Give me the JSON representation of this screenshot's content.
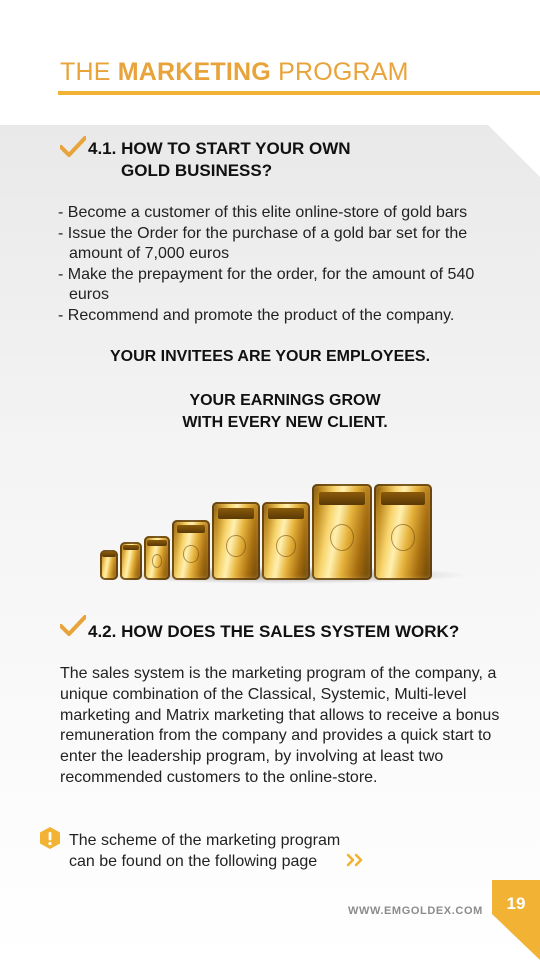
{
  "header": {
    "title_pre": "THE ",
    "title_bold": "MARKETING",
    "title_post": " PROGRAM"
  },
  "section1": {
    "heading_line1": "4.1. HOW TO START YOUR OWN",
    "heading_line2": "GOLD BUSINESS?",
    "bullets": [
      "- Become a customer of this elite online-store of gold bars",
      "- Issue the Order for the purchase of a gold bar set for the amount of 7,000 euros",
      "- Make the prepayment for the order, for the amount of 540 euros",
      "- Recommend and promote the product of the company."
    ],
    "callout1": "YOUR INVITEES ARE YOUR EMPLOYEES.",
    "callout2_line1": "YOUR EARNINGS GROW",
    "callout2_line2": "WITH EVERY NEW CLIENT."
  },
  "section2": {
    "heading": "4.2. HOW DOES THE SALES SYSTEM WORK?",
    "paragraph": "The sales system is the marketing program of the company, a unique combination of the Classical, Systemic, Multi-level marketing and Matrix marketing that allows to receive a bonus remuneration from the company and provides a quick start to enter the leadership program, by involving at least two recommended customers to the online-store.",
    "note_line1": "The scheme of the marketing program",
    "note_line2": "can be found on the following page"
  },
  "footer": {
    "url": "WWW.EMGOLDEX.COM",
    "page_number": "19"
  },
  "icons": {
    "check": "check-icon",
    "info": "exclamation-hexagon-icon",
    "next": "double-chevron-right-icon"
  },
  "colors": {
    "accent": "#f2b233",
    "header_text": "#e8a33a",
    "body_text": "#222222"
  }
}
